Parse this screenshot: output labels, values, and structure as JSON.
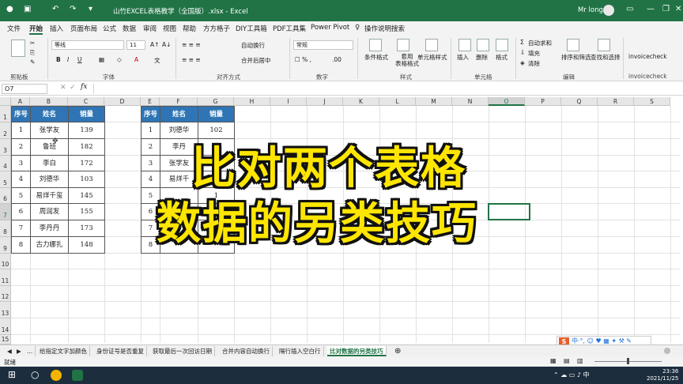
{
  "titlebar": {
    "title": "山竹EXCEL表格教学（全国版）.xlsx  -  Excel",
    "user": "Mr long"
  },
  "menu": {
    "tabs": [
      "文件",
      "开始",
      "插入",
      "页面布局",
      "公式",
      "数据",
      "审阅",
      "视图",
      "帮助",
      "方方格子",
      "DIY工具箱",
      "PDF工具集",
      "Power Pivot",
      "操作说明搜索"
    ],
    "active": "开始"
  },
  "ribbon": {
    "groups": [
      "剪贴板",
      "字体",
      "对齐方式",
      "数字",
      "样式",
      "单元格",
      "编辑"
    ],
    "font_name": "等线",
    "font_size": "11",
    "number_format": "常规",
    "wrap_text": "自动换行",
    "merge_center": "合并后居中",
    "cond_format": "条件格式",
    "table_format": "套用\n表格格式",
    "cell_style": "单元格样式",
    "insert": "插入",
    "delete": "删除",
    "format": "格式",
    "autosum": "自动求和",
    "fill": "填充",
    "clear": "清除",
    "sort_filter": "排序和筛选",
    "find_select": "查找和选择",
    "addin1": "invoicecheck",
    "addin2": "invoicecheck"
  },
  "formula_bar": {
    "name_box": "O7",
    "fx": "fx"
  },
  "columns": [
    "A",
    "B",
    "C",
    "D",
    "E",
    "F",
    "G",
    "H",
    "I",
    "J",
    "K",
    "L",
    "M",
    "N",
    "O",
    "P",
    "Q",
    "R",
    "S"
  ],
  "rows": [
    "1",
    "2",
    "3",
    "4",
    "5",
    "6",
    "7",
    "8",
    "9",
    "10",
    "11",
    "12",
    "13",
    "14",
    "15"
  ],
  "table1": {
    "headers": [
      "序号",
      "姓名",
      "销量"
    ],
    "rows": [
      [
        "1",
        "张学友",
        "139"
      ],
      [
        "2",
        "鲁班",
        "182"
      ],
      [
        "3",
        "李白",
        "172"
      ],
      [
        "4",
        "刘德华",
        "103"
      ],
      [
        "5",
        "易烊千玺",
        "145"
      ],
      [
        "6",
        "周润发",
        "155"
      ],
      [
        "7",
        "李丹丹",
        "173"
      ],
      [
        "8",
        "古力娜扎",
        "148"
      ]
    ]
  },
  "table2": {
    "headers": [
      "序号",
      "姓名",
      "销量"
    ],
    "rows": [
      [
        "1",
        "刘德华",
        "102"
      ],
      [
        "2",
        "李丹",
        ""
      ],
      [
        "3",
        "张学友",
        ""
      ],
      [
        "4",
        "易烊千",
        ""
      ],
      [
        "5",
        "",
        "1"
      ],
      [
        "6",
        "",
        ""
      ],
      [
        "7",
        "",
        ""
      ],
      [
        "8",
        "",
        ""
      ]
    ]
  },
  "overlay": {
    "line1": "比对两个表格",
    "line2": "数据的另类技巧"
  },
  "sheets": {
    "nav": "...",
    "tabs": [
      "给指定文字加颜色",
      "身份证号是否重复",
      "获取最后一次回访日期",
      "合并内容自动换行",
      "隔行插入空白行",
      "比对数据的另类技巧"
    ],
    "active": "比对数据的另类技巧"
  },
  "status": "就绪",
  "ime": "中·°, ☺ ♥ ▦ ✦ ⚒ ✎",
  "clock": {
    "time": "23:36",
    "date": "2021/11/25"
  },
  "colors": {
    "excel_green": "#217346",
    "header_blue": "#2f75b5",
    "overlay_yellow": "#ffe600"
  }
}
